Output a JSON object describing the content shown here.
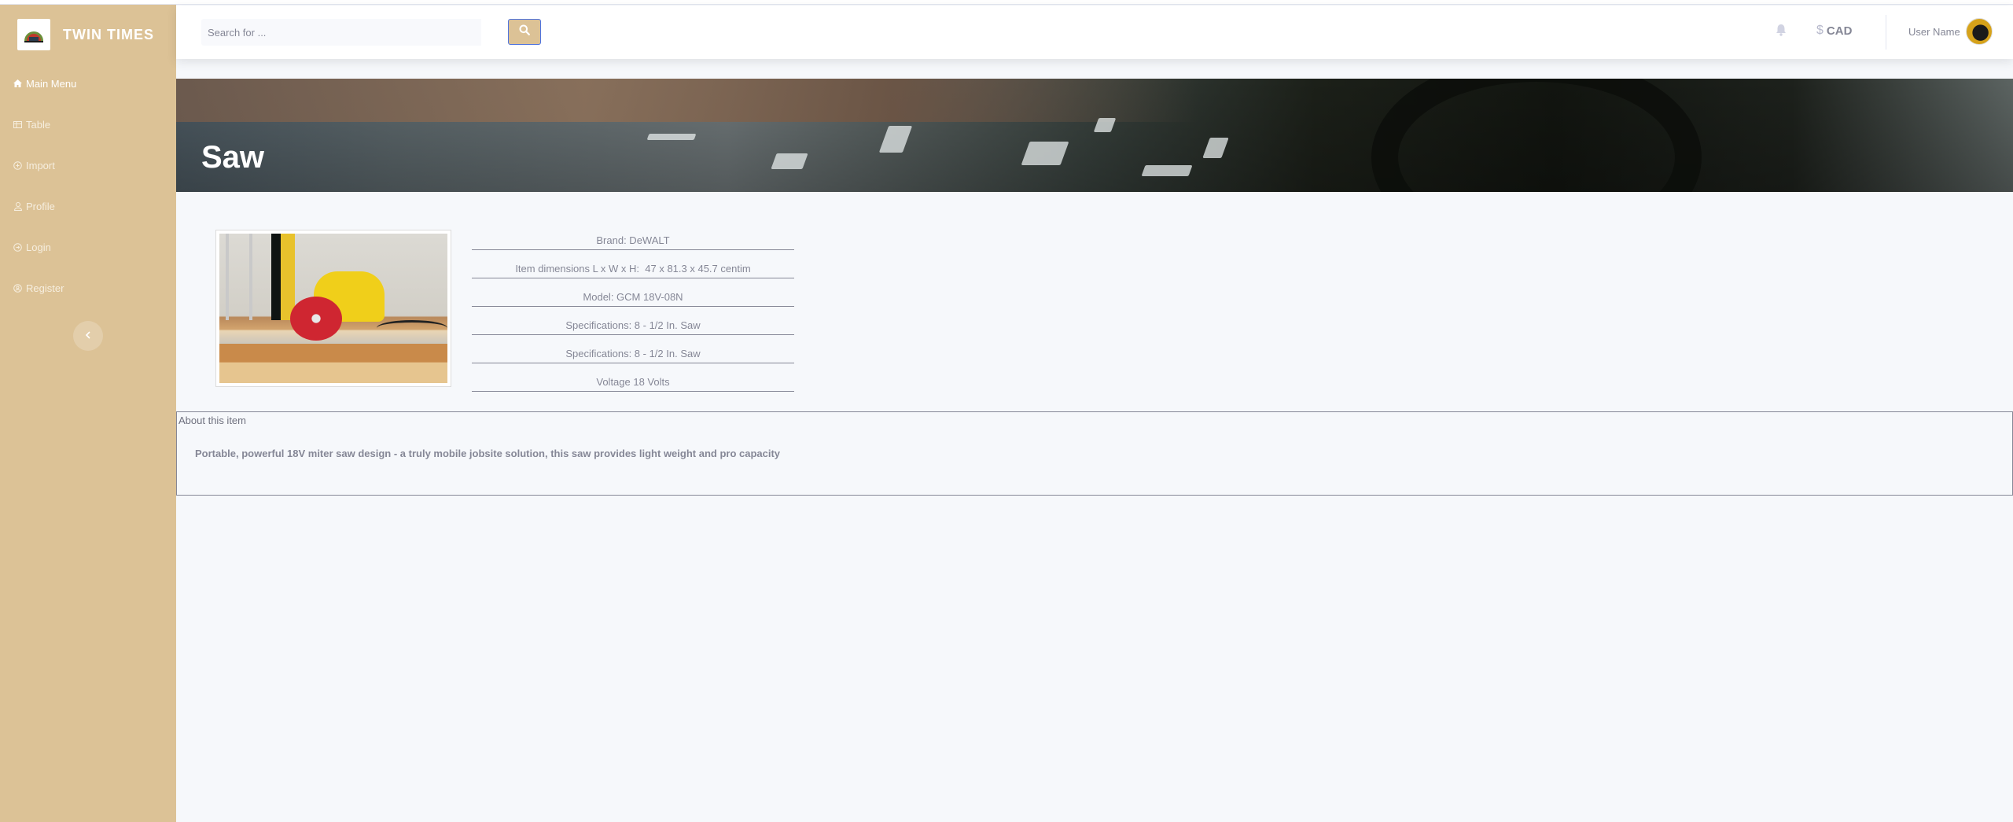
{
  "brand": {
    "name": "TWIN TIMES"
  },
  "sidebar": {
    "items": [
      {
        "label": "Main Menu",
        "icon": "home-icon"
      },
      {
        "label": "Table",
        "icon": "table-icon"
      },
      {
        "label": "Import",
        "icon": "import-icon"
      },
      {
        "label": "Profile",
        "icon": "user-icon"
      },
      {
        "label": "Login",
        "icon": "login-icon"
      },
      {
        "label": "Register",
        "icon": "register-icon"
      }
    ],
    "toggle_icon": "chevron-left-icon"
  },
  "topbar": {
    "search_placeholder": "Search for ...",
    "search_icon": "search-icon",
    "bell_icon": "bell-icon",
    "currency_symbol": "$",
    "currency_code": "CAD",
    "user_name": "User Name"
  },
  "product": {
    "title": "Saw",
    "specs": [
      "Brand: DeWALT",
      "Item dimensions L x W x H:  47 x 81.3 x 45.7 centim",
      "Model: GCM 18V-08N",
      "Specifications: 8 - 1/2 In. Saw",
      "Specifications: 8 - 1/2 In. Saw",
      "Voltage 18 Volts"
    ]
  },
  "about": {
    "title": "About this item",
    "text": "Portable, powerful 18V miter saw design - a truly mobile jobsite solution, this saw provides light weight and pro capacity"
  },
  "colors": {
    "sidebar": "#dcc296",
    "background": "#f6f8fb",
    "text_muted": "#858796",
    "search_button_border": "#4e73df"
  }
}
